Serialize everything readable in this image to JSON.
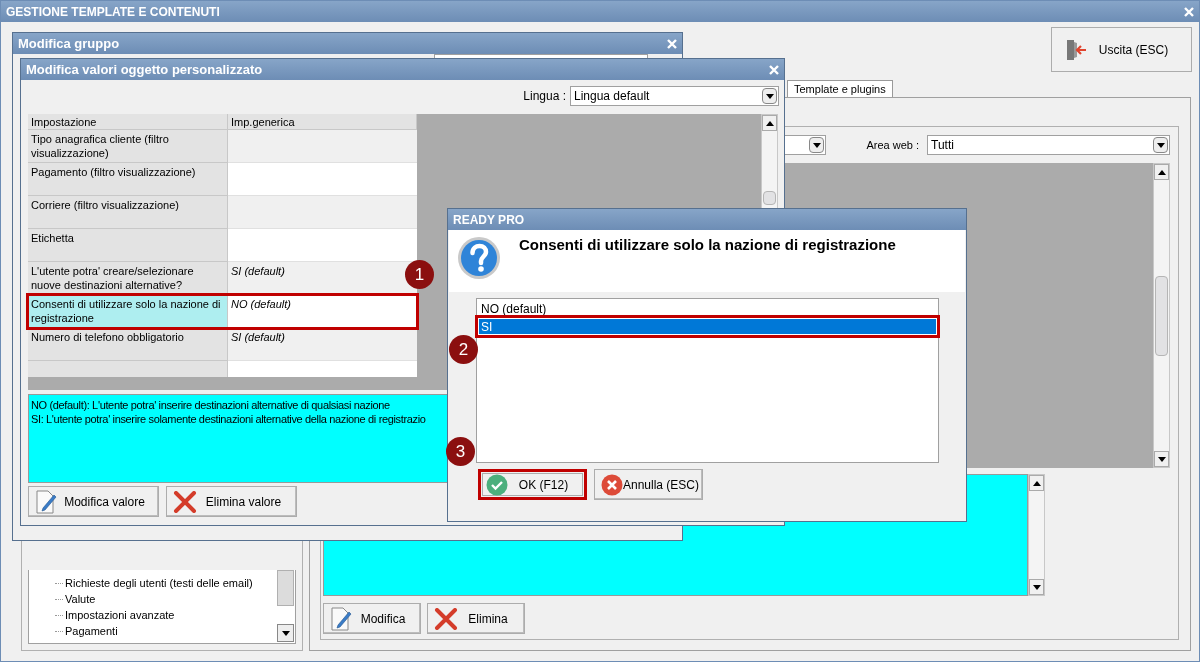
{
  "main_window": {
    "title": "GESTIONE TEMPLATE E CONTENUTI",
    "exit_button": "Uscita (ESC)",
    "tab": "Template e plugins",
    "filter": {
      "label": "Area web :",
      "value": "Tutti"
    },
    "tree_items": [
      "Richieste degli utenti (testi delle email)",
      "Valute",
      "Impostazioni avanzate",
      "Pagamenti"
    ],
    "buttons": [
      {
        "label": "Modifica",
        "kind": "edit"
      },
      {
        "label": "Elimina",
        "kind": "delete"
      }
    ]
  },
  "group_window": {
    "title": "Modifica gruppo"
  },
  "values_window": {
    "title": "Modifica valori oggetto personalizzato",
    "language": {
      "label": "Lingua :",
      "value": "Lingua default"
    },
    "columns": [
      "Impostazione",
      "Imp.generica"
    ],
    "rows": [
      {
        "setting": "Tipo anagrafica cliente (filtro visualizzazione)",
        "selected": false,
        "highlighted": false
      },
      {
        "setting": "Pagamento (filtro visualizzazione)",
        "selected": false,
        "highlighted": false
      },
      {
        "setting": "Corriere (filtro visualizzazione)",
        "selected": false,
        "highlighted": false
      },
      {
        "setting": "Etichetta",
        "selected": false,
        "highlighted": false
      },
      {
        "setting": "L'utente potra' creare/selezionare nuove destinazioni alternative?",
        "value": "SI (default)",
        "selected": false,
        "highlighted": false
      },
      {
        "setting": "Consenti di utilizzare solo la nazione di registrazione",
        "value": "NO (default)",
        "selected": true,
        "highlighted": true
      },
      {
        "setting": "Numero di telefono obbligatorio",
        "value": "SI (default)",
        "selected": false,
        "highlighted": false
      }
    ],
    "description": [
      "NO (default): L'utente potra' inserire destinazioni alternative di qualsiasi nazione",
      "SI: L'utente potra' inserire solamente destinazioni alternative della nazione di registrazio"
    ],
    "buttons": [
      {
        "label": "Modifica valore",
        "kind": "edit"
      },
      {
        "label": "Elimina valore",
        "kind": "delete"
      }
    ]
  },
  "dialog": {
    "title": "READY PRO",
    "question": "Consenti di utilizzare solo la nazione di registrazione",
    "options": [
      {
        "label": "NO (default)",
        "selected": false,
        "highlighted": false
      },
      {
        "label": "SI",
        "selected": true,
        "highlighted": true
      }
    ],
    "buttons": [
      {
        "label": "OK (F12)",
        "kind": "ok",
        "highlighted": true
      },
      {
        "label": "Annulla (ESC)",
        "kind": "cancel",
        "highlighted": false
      }
    ]
  },
  "annotations": [
    {
      "number": "1"
    },
    {
      "number": "2"
    },
    {
      "number": "3"
    }
  ]
}
